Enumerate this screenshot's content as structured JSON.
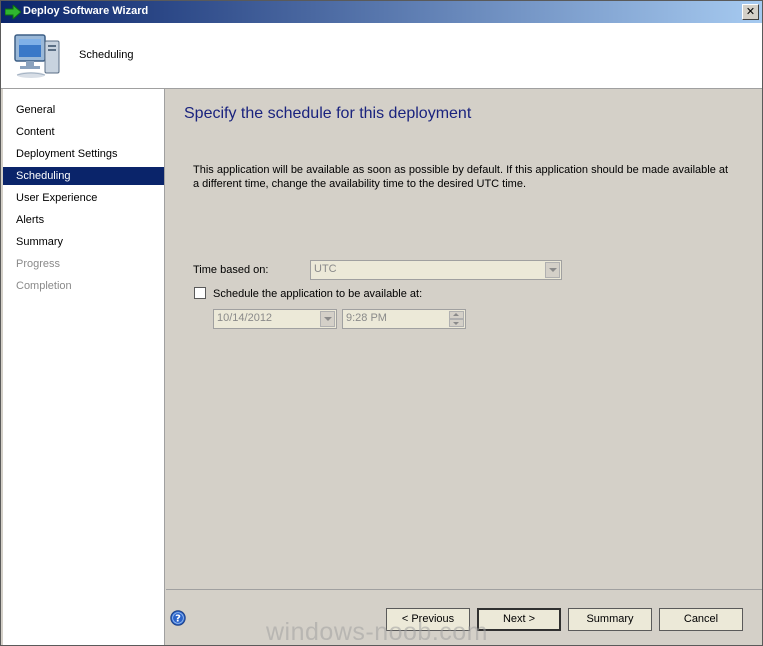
{
  "window": {
    "title": "Deploy Software Wizard",
    "close_glyph": "✕"
  },
  "header": {
    "step_title": "Scheduling",
    "icon": "computer-icon"
  },
  "sidebar": {
    "items": [
      {
        "label": "General",
        "state": "normal"
      },
      {
        "label": "Content",
        "state": "normal"
      },
      {
        "label": "Deployment Settings",
        "state": "normal"
      },
      {
        "label": "Scheduling",
        "state": "active"
      },
      {
        "label": "User Experience",
        "state": "normal"
      },
      {
        "label": "Alerts",
        "state": "normal"
      },
      {
        "label": "Summary",
        "state": "normal"
      },
      {
        "label": "Progress",
        "state": "disabled"
      },
      {
        "label": "Completion",
        "state": "disabled"
      }
    ]
  },
  "main": {
    "heading": "Specify the schedule for this deployment",
    "description": "This application will be available as soon as possible by default. If this application should be made available at a different time, change the availability time to the desired UTC time.",
    "time_based_on_label": "Time based on:",
    "time_based_on_value": "UTC",
    "schedule_checkbox_label": "Schedule the application to be available at:",
    "schedule_checked": false,
    "date_value": "10/14/2012",
    "time_value": "9:28 PM"
  },
  "footer": {
    "previous_label": "< Previous",
    "next_label": "Next >",
    "summary_label": "Summary",
    "cancel_label": "Cancel"
  },
  "watermark": "windows-noob.com",
  "colors": {
    "heading": "#1a237e",
    "selection": "#0a246a",
    "disabled_text": "#8a8a8a"
  }
}
